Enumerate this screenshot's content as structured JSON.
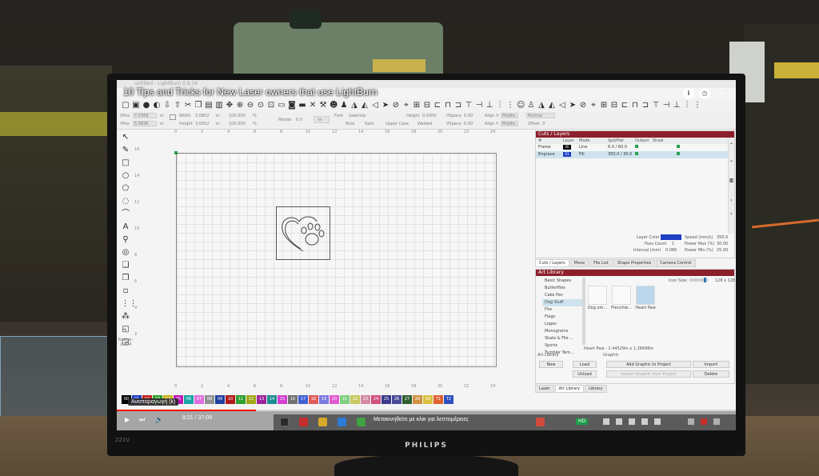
{
  "video": {
    "title": "10 Tips and Tricks for New Laser owners that use LightBurn",
    "time": "8:21 / 37:09",
    "progress": 0.225,
    "hover_tooltip": "Αναπαραγωγή (k)",
    "drag_hint": "Μετακινηθείτε με κλικ για λεπτομέρειες",
    "quality_badge": "HD"
  },
  "monitor": {
    "brand": "PHILIPS",
    "model": "221V"
  },
  "app": {
    "window_title": "untitled - LightBurn 0.9.16",
    "props": {
      "xpos_label": "XPos",
      "xpos_value": "7.0368",
      "ypos_label": "YPos",
      "ypos_value": "5.9696",
      "unit": "in",
      "width_label": "Width",
      "width_value": "3.0802",
      "height_label": "Height",
      "height_value": "3.0052",
      "scale_w": "100.000",
      "scale_h": "100.000",
      "pct": "%",
      "rotate_label": "Rotate",
      "rotate_value": "0.0",
      "font_label": "Font",
      "font_value": "Gabriola",
      "bold_label": "Bold",
      "italic_label": "Italic",
      "uppercase_label": "Upper Case",
      "welded_label": "Welded",
      "height2_label": "Height",
      "height2_value": "0.5000",
      "hspace_label": "HSpace",
      "hspace_value": "0.00",
      "vspace_label": "VSpace",
      "vspace_value": "0.00",
      "alignx_label": "Align X",
      "alignx_value": "Middle",
      "aligny_label": "Align Y",
      "aligny_value": "Middle",
      "normal_label": "Normal",
      "offset_label": "Offset",
      "offset_value": "0"
    },
    "radius_label": "Radius:",
    "radius_value": "2.304",
    "ruler_top": [
      "0",
      "2",
      "4",
      "6",
      "8",
      "10",
      "12",
      "14",
      "16",
      "18",
      "20",
      "22",
      "24"
    ],
    "ruler_left": [
      "16",
      "14",
      "12",
      "10",
      "8",
      "6",
      "4",
      "2"
    ],
    "ruler_bottom": [
      "0",
      "2",
      "4",
      "6",
      "8",
      "10",
      "12",
      "14",
      "16",
      "18",
      "20",
      "22",
      "24"
    ],
    "palette": [
      {
        "label": "00",
        "color": "#000000"
      },
      {
        "label": "01",
        "color": "#1f3fc4"
      },
      {
        "label": "02",
        "color": "#c21f1f"
      },
      {
        "label": "03",
        "color": "#2aa02a"
      },
      {
        "label": "04",
        "color": "#c9b410"
      },
      {
        "label": "05",
        "color": "#c015b8"
      },
      {
        "label": "06",
        "color": "#18a6a6"
      },
      {
        "label": "07",
        "color": "#e070e0"
      },
      {
        "label": "08",
        "color": "#909090"
      },
      {
        "label": "09",
        "color": "#1f3fa0"
      },
      {
        "label": "10",
        "color": "#b01818"
      },
      {
        "label": "11",
        "color": "#2f9e2f"
      },
      {
        "label": "12",
        "color": "#a3a81a"
      },
      {
        "label": "13",
        "color": "#9c239c"
      },
      {
        "label": "14",
        "color": "#1b8e8e"
      },
      {
        "label": "15",
        "color": "#d23fd2"
      },
      {
        "label": "16",
        "color": "#6f6f6f"
      },
      {
        "label": "17",
        "color": "#4060d0"
      },
      {
        "label": "18",
        "color": "#e05a5a"
      },
      {
        "label": "19",
        "color": "#7a7ae0"
      },
      {
        "label": "20",
        "color": "#e05ad0"
      },
      {
        "label": "21",
        "color": "#7fcf7f"
      },
      {
        "label": "22",
        "color": "#c8c860"
      },
      {
        "label": "23",
        "color": "#d48aa0"
      },
      {
        "label": "24",
        "color": "#d05080"
      },
      {
        "label": "25",
        "color": "#3a3a8a"
      },
      {
        "label": "26",
        "color": "#4a4a9a"
      },
      {
        "label": "27",
        "color": "#2f5f2f"
      },
      {
        "label": "28",
        "color": "#d09040"
      },
      {
        "label": "29",
        "color": "#d8c040"
      },
      {
        "label": "T1",
        "color": "#e06030"
      },
      {
        "label": "T2",
        "color": "#3050c0"
      }
    ],
    "cuts": {
      "title": "Cuts / Layers",
      "columns": [
        "#",
        "Layer",
        "Mode",
        "Spd/Pwr",
        "Output",
        "Show"
      ],
      "rows": [
        {
          "name": "Frame",
          "layer": "00",
          "layer_color": "#000000",
          "mode": "Line",
          "spdpwr": "6.0 / 60.0"
        },
        {
          "name": "Engrave",
          "layer": "01",
          "layer_color": "#1f3fc4",
          "mode": "Fill",
          "spdpwr": "350.0 / 30.0"
        }
      ],
      "layer_color_label": "Layer Color",
      "speed_label": "Speed (mm/s)",
      "speed_value": "350.0",
      "passes_label": "Pass Count",
      "passes_value": "1",
      "powermax_label": "Power Max (%)",
      "powermax_value": "30.00",
      "interval_label": "Interval (mm)",
      "interval_value": "0.080",
      "powermin_label": "Power Min (%)",
      "powermin_value": "25.00"
    },
    "mid_tabs": [
      "Cuts / Layers",
      "Move",
      "File List",
      "Shape Properties",
      "Camera Control"
    ],
    "library": {
      "title": "Art Library",
      "icon_size_label": "Icon Size:",
      "icon_size_value": "128 x 128",
      "categories": [
        "Basic Shapes",
        "Butterflies",
        "Cake Pan",
        "Dog Stuff",
        "Fire",
        "Flags",
        "Logos",
        "Monograms",
        "Skate & File ...",
        "Sports",
        "Tumbler Tem..."
      ],
      "selected_category": "Dog Stuff",
      "thumbs": [
        "Dog om...",
        "Frenchie...",
        "Heart Paw"
      ],
      "selection_info": "Heart Paw - 1.44529in x 1.28498in",
      "art_library_label": "Art Library",
      "graphic_label": "Graphic",
      "btn_new": "New",
      "btn_load": "Load",
      "btn_unload": "Unload",
      "btn_add": "Add Graphic to Project",
      "btn_import_proj": "Import Graphic from Project",
      "btn_import": "Import",
      "btn_delete": "Delete"
    },
    "bottom_tabs": [
      "Laser",
      "Art Library",
      "Library"
    ]
  }
}
